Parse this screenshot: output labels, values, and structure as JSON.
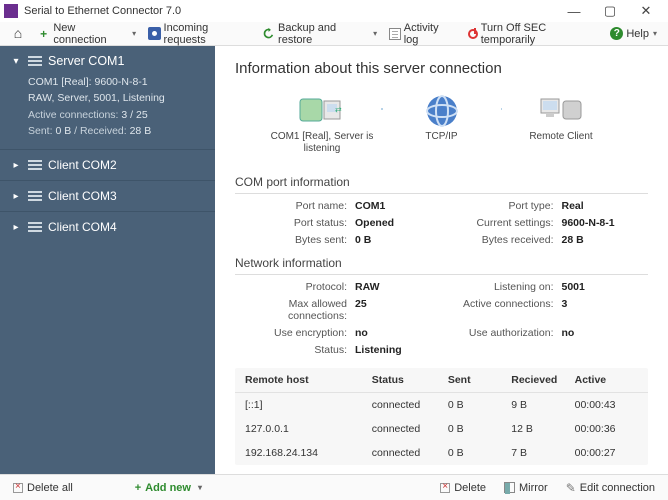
{
  "window": {
    "title": "Serial to Ethernet Connector 7.0"
  },
  "toolbar": {
    "new_connection": "New connection",
    "incoming_requests": "Incoming requests",
    "backup_restore": "Backup and restore",
    "activity_log": "Activity log",
    "turn_off": "Turn Off SEC temporarily",
    "help": "Help"
  },
  "sidebar": {
    "server": {
      "name": "Server COM1",
      "line1": "COM1 [Real]: 9600-N-8-1",
      "line2": "RAW, Server, 5001, Listening",
      "active_label": "Active connections:",
      "active_value": "3 / 25",
      "sent_label": "Sent:",
      "sent_value": "0 B",
      "recv_label": "/ Received:",
      "recv_value": "28 B"
    },
    "clients": [
      {
        "name": "Client COM2"
      },
      {
        "name": "Client COM3"
      },
      {
        "name": "Client COM4"
      }
    ]
  },
  "main": {
    "heading": "Information about this server connection",
    "flow": {
      "node1": "COM1 [Real], Server is listening",
      "node2": "TCP/IP",
      "node3": "Remote Client"
    },
    "com_section": {
      "title": "COM port information",
      "port_name_k": "Port name:",
      "port_name_v": "COM1",
      "port_type_k": "Port type:",
      "port_type_v": "Real",
      "port_status_k": "Port status:",
      "port_status_v": "Opened",
      "current_settings_k": "Current settings:",
      "current_settings_v": "9600-N-8-1",
      "bytes_sent_k": "Bytes sent:",
      "bytes_sent_v": "0 B",
      "bytes_received_k": "Bytes received:",
      "bytes_received_v": "28 B"
    },
    "net_section": {
      "title": "Network information",
      "protocol_k": "Protocol:",
      "protocol_v": "RAW",
      "listening_k": "Listening on:",
      "listening_v": "5001",
      "max_k": "Max allowed connections:",
      "max_v": "25",
      "active_k": "Active connections:",
      "active_v": "3",
      "enc_k": "Use encryption:",
      "enc_v": "no",
      "auth_k": "Use authorization:",
      "auth_v": "no",
      "status_k": "Status:",
      "status_v": "Listening"
    },
    "table": {
      "headers": {
        "host": "Remote host",
        "status": "Status",
        "sent": "Sent",
        "recv": "Recieved",
        "active": "Active"
      },
      "rows": [
        {
          "host": "[::1]",
          "status": "connected",
          "sent": "0 B",
          "recv": "9 B",
          "active": "00:00:43"
        },
        {
          "host": "127.0.0.1",
          "status": "connected",
          "sent": "0 B",
          "recv": "12 B",
          "active": "00:00:36"
        },
        {
          "host": "192.168.24.134",
          "status": "connected",
          "sent": "0 B",
          "recv": "7 B",
          "active": "00:00:27"
        }
      ]
    }
  },
  "footer": {
    "delete_all": "Delete all",
    "add_new": "Add new",
    "delete": "Delete",
    "mirror": "Mirror",
    "edit": "Edit connection"
  }
}
